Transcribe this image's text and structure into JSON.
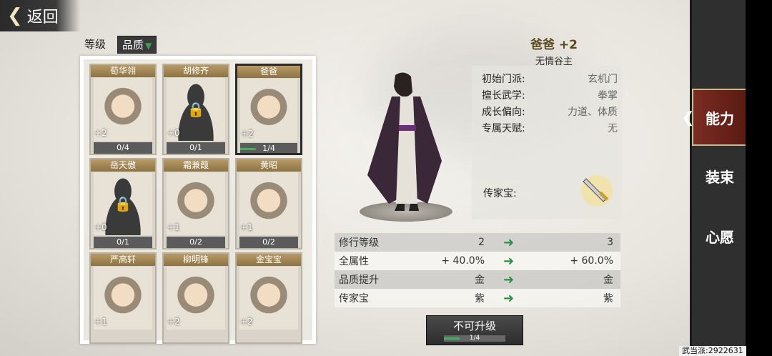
{
  "back_label": "返回",
  "filters": [
    {
      "label": "等级"
    },
    {
      "label": "品质"
    }
  ],
  "characters": [
    {
      "name": "荀华翎",
      "bonus": "+2",
      "progress": "0/4",
      "fill": 0,
      "locked": false
    },
    {
      "name": "胡修齐",
      "bonus": "+0",
      "progress": "0/1",
      "fill": 0,
      "locked": true
    },
    {
      "name": "爸爸",
      "bonus": "+2",
      "progress": "1/4",
      "fill": 0.25,
      "locked": false,
      "selected": true
    },
    {
      "name": "岳天傲",
      "bonus": "+0",
      "progress": "0/1",
      "fill": 0,
      "locked": true
    },
    {
      "name": "霜兼葭",
      "bonus": "+1",
      "progress": "0/2",
      "fill": 0,
      "locked": false
    },
    {
      "name": "黄昭",
      "bonus": "+1",
      "progress": "0/2",
      "fill": 0,
      "locked": false
    },
    {
      "name": "严高轩",
      "bonus": "+1",
      "progress": "",
      "fill": 0,
      "locked": false
    },
    {
      "name": "柳明锋",
      "bonus": "+2",
      "progress": "",
      "fill": 0,
      "locked": false
    },
    {
      "name": "金宝宝",
      "bonus": "+2",
      "progress": "",
      "fill": 0,
      "locked": false
    }
  ],
  "hero": {
    "name": "爸爸 +2",
    "title": "无情谷主"
  },
  "attributes": [
    {
      "key": "初始门派:",
      "value": "玄机门"
    },
    {
      "key": "擅长武学:",
      "value": "拳掌"
    },
    {
      "key": "成长偏向:",
      "value": "力道、体质"
    },
    {
      "key": "专属天赋:",
      "value": "无"
    }
  ],
  "treasure_label": "传家宝:",
  "upgrade": [
    {
      "key": "修行等级",
      "before": "2",
      "after": "3"
    },
    {
      "key": "全属性",
      "before": "+ 40.0%",
      "after": "+ 60.0%"
    },
    {
      "key": "品质提升",
      "before": "金",
      "after": "金"
    },
    {
      "key": "传家宝",
      "before": "紫",
      "after": "紫"
    }
  ],
  "upgrade_button": {
    "label": "不可升级",
    "progress": "1/4",
    "fill": 0.25
  },
  "side_tabs": [
    {
      "label": "能力",
      "active": true
    },
    {
      "label": "装束",
      "active": false
    },
    {
      "label": "心愿",
      "active": false
    }
  ],
  "footer": "武当派:2922631"
}
